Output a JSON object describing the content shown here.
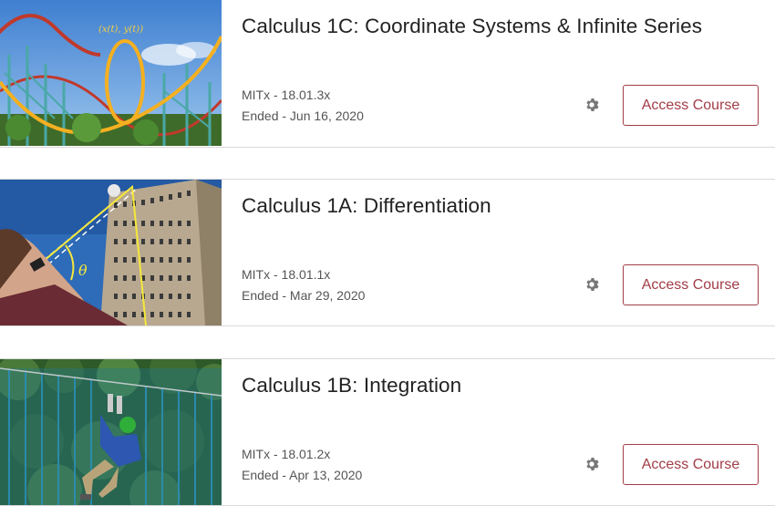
{
  "courses": [
    {
      "title": "Calculus 1C: Coordinate Systems & Infinite Series",
      "code": "MITx - 18.01.3x",
      "status": "Ended - Jun 16, 2020",
      "button_label": "Access Course",
      "image_label": "(x(t), y(t))"
    },
    {
      "title": "Calculus 1A: Differentiation",
      "code": "MITx - 18.01.1x",
      "status": "Ended - Mar 29, 2020",
      "button_label": "Access Course",
      "image_label": "θ"
    },
    {
      "title": "Calculus 1B: Integration",
      "code": "MITx - 18.01.2x",
      "status": "Ended - Apr 13, 2020",
      "button_label": "Access Course"
    }
  ],
  "colors": {
    "accent": "#a23d48",
    "divider": "#d9d9d9",
    "gear": "#777777"
  },
  "icons": {
    "settings": "gear-icon"
  }
}
